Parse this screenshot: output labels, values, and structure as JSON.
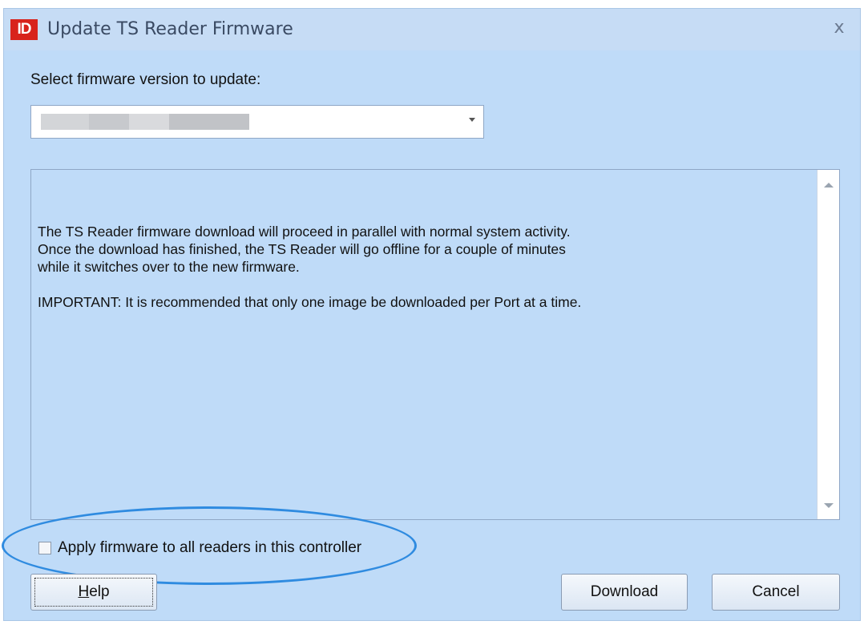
{
  "window": {
    "icon_text": "ID",
    "title": "Update TS Reader Firmware",
    "close_glyph": "x"
  },
  "form": {
    "select_label": "Select firmware version to update:",
    "selected_value": ""
  },
  "message": {
    "text": "The TS Reader firmware download will proceed in parallel with normal system activity.\nOnce the download has finished, the TS Reader will go offline for a couple of minutes\nwhile it switches over to the new firmware.\n\nIMPORTANT: It is recommended that only one image be downloaded per Port at a time."
  },
  "checkbox": {
    "label": "Apply firmware to all readers in this controller",
    "checked": false
  },
  "buttons": {
    "help_first": "H",
    "help_rest": "elp",
    "download": "Download",
    "cancel": "Cancel"
  },
  "colors": {
    "background": "#bfdbf8",
    "highlight_ring": "#2f8be0",
    "app_icon": "#d8231c"
  }
}
